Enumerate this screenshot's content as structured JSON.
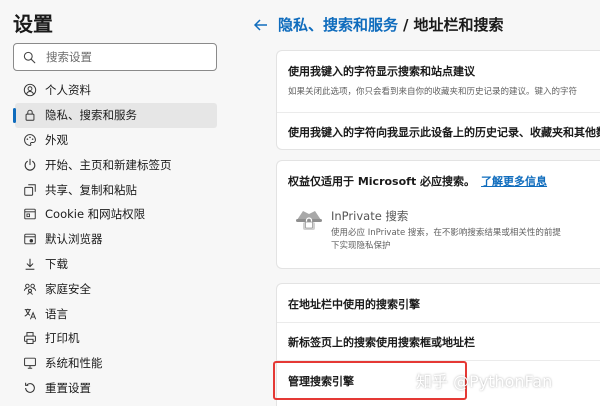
{
  "sidebar": {
    "title": "设置",
    "search_placeholder": "搜索设置",
    "items": [
      {
        "label": "个人资料",
        "icon": "profile-icon"
      },
      {
        "label": "隐私、搜索和服务",
        "icon": "lock-icon",
        "active": true
      },
      {
        "label": "外观",
        "icon": "appearance-icon"
      },
      {
        "label": "开始、主页和新建标签页",
        "icon": "power-icon"
      },
      {
        "label": "共享、复制和粘贴",
        "icon": "share-icon"
      },
      {
        "label": "Cookie 和网站权限",
        "icon": "cookie-icon"
      },
      {
        "label": "默认浏览器",
        "icon": "browser-icon"
      },
      {
        "label": "下载",
        "icon": "download-icon"
      },
      {
        "label": "家庭安全",
        "icon": "family-icon"
      },
      {
        "label": "语言",
        "icon": "language-icon"
      },
      {
        "label": "打印机",
        "icon": "printer-icon"
      },
      {
        "label": "系统和性能",
        "icon": "system-icon"
      },
      {
        "label": "重置设置",
        "icon": "reset-icon"
      }
    ]
  },
  "main": {
    "breadcrumb_link": "隐私、搜索和服务",
    "breadcrumb_sep": "/",
    "breadcrumb_current": "地址栏和搜索",
    "card1": {
      "row1_title": "使用我键入的字符显示搜索和站点建议",
      "row1_sub": "如果关闭此选项，你只会看到来自你的收藏夹和历史记录的建议。键入的字符",
      "row2_title": "使用我键入的字符向我显示此设备上的历史记录、收藏夹和其他数"
    },
    "card2": {
      "title": "权益仅适用于 Microsoft 必应搜索。",
      "link": "了解更多信息",
      "inprivate_title": "InPrivate 搜索",
      "inprivate_desc_line1": "使用必应 InPrivate 搜索，在不影响搜索结果或相关性的前提",
      "inprivate_desc_line2": "下实现隐私保护"
    },
    "card3": {
      "row1": "在地址栏中使用的搜索引擎",
      "row2": "新标签页上的搜索使用搜索框或地址栏",
      "row3": "管理搜索引擎"
    }
  },
  "watermark": "知乎 @PythonFan",
  "colors": {
    "accent": "#0f6cbd",
    "highlight": "#e53935"
  }
}
